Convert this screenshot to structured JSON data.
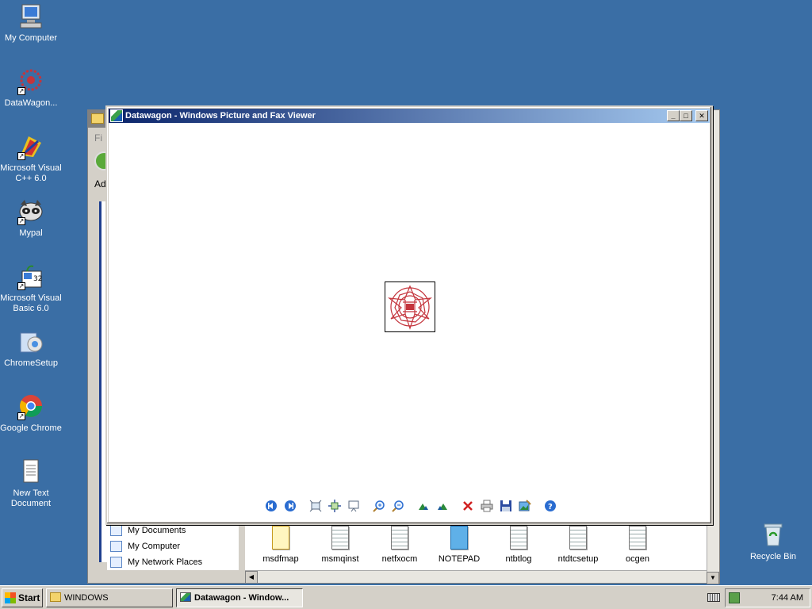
{
  "desktop": {
    "icons": [
      {
        "label": "My Computer"
      },
      {
        "label": "DataWagon..."
      },
      {
        "label": "Microsoft Visual C++ 6.0"
      },
      {
        "label": "Mypal"
      },
      {
        "label": "Microsoft Visual Basic 6.0"
      },
      {
        "label": "ChromeSetup"
      },
      {
        "label": "Google Chrome"
      },
      {
        "label": "New Text Document"
      },
      {
        "label": "Recycle Bin"
      }
    ]
  },
  "explorer": {
    "menu_partial": "Fi",
    "address_partial": "Ad",
    "places": [
      {
        "label": "My Documents"
      },
      {
        "label": "My Computer"
      },
      {
        "label": "My Network Places"
      }
    ],
    "files": [
      {
        "name": "msdfmap"
      },
      {
        "name": "msmqinst"
      },
      {
        "name": "netfxocm"
      },
      {
        "name": "NOTEPAD"
      },
      {
        "name": "ntbtlog"
      },
      {
        "name": "ntdtcsetup"
      },
      {
        "name": "ocgen"
      }
    ]
  },
  "viewer": {
    "title": "Datawagon - Windows Picture and Fax Viewer",
    "minimize": "_",
    "maximize": "□",
    "close": "✕"
  },
  "taskbar": {
    "start": "Start",
    "items": [
      {
        "label": "WINDOWS",
        "active": false
      },
      {
        "label": "Datawagon - Window...",
        "active": true
      }
    ],
    "clock": "7:44 AM"
  },
  "colors": {
    "desktop": "#3a6ea5",
    "titlebar_start": "#0a246a",
    "titlebar_end": "#a6caf0",
    "face": "#d4d0c8",
    "logo_red": "#c4343c"
  }
}
